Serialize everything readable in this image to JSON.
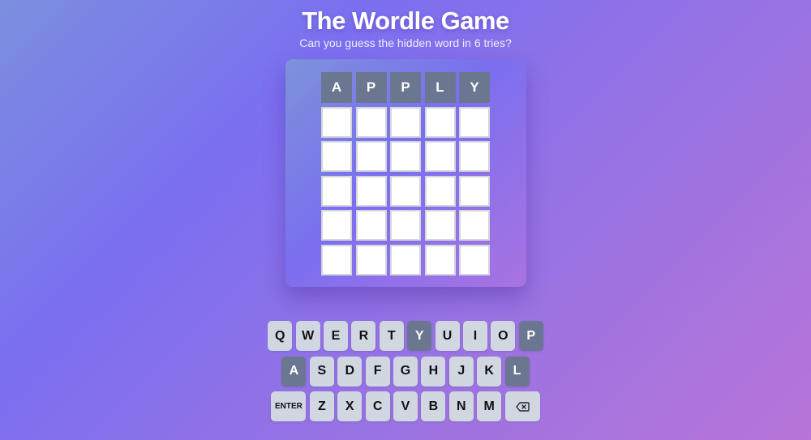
{
  "header": {
    "title": "The Wordle Game",
    "subtitle": "Can you guess the hidden word in 6 tries?"
  },
  "board": {
    "rows": [
      [
        "A",
        "P",
        "P",
        "L",
        "Y"
      ],
      [
        "",
        "",
        "",
        "",
        ""
      ],
      [
        "",
        "",
        "",
        "",
        ""
      ],
      [
        "",
        "",
        "",
        "",
        ""
      ],
      [
        "",
        "",
        "",
        "",
        ""
      ],
      [
        "",
        "",
        "",
        "",
        ""
      ]
    ],
    "filled_color": "#6b7790",
    "empty_color": "#ffffff"
  },
  "keyboard": {
    "rows": [
      [
        {
          "label": "Q",
          "used": false
        },
        {
          "label": "W",
          "used": false
        },
        {
          "label": "E",
          "used": false
        },
        {
          "label": "R",
          "used": false
        },
        {
          "label": "T",
          "used": false
        },
        {
          "label": "Y",
          "used": true
        },
        {
          "label": "U",
          "used": false
        },
        {
          "label": "I",
          "used": false
        },
        {
          "label": "O",
          "used": false
        },
        {
          "label": "P",
          "used": true
        }
      ],
      [
        {
          "label": "A",
          "used": true
        },
        {
          "label": "S",
          "used": false
        },
        {
          "label": "D",
          "used": false
        },
        {
          "label": "F",
          "used": false
        },
        {
          "label": "G",
          "used": false
        },
        {
          "label": "H",
          "used": false
        },
        {
          "label": "J",
          "used": false
        },
        {
          "label": "K",
          "used": false
        },
        {
          "label": "L",
          "used": true
        }
      ],
      [
        {
          "label": "ENTER",
          "used": false,
          "wide": true
        },
        {
          "label": "Z",
          "used": false
        },
        {
          "label": "X",
          "used": false
        },
        {
          "label": "C",
          "used": false
        },
        {
          "label": "V",
          "used": false
        },
        {
          "label": "B",
          "used": false
        },
        {
          "label": "N",
          "used": false
        },
        {
          "label": "M",
          "used": false
        },
        {
          "label": "",
          "icon": "backspace-icon",
          "used": false,
          "wide": true
        }
      ]
    ],
    "key_color": "#d1d7e1",
    "used_key_color": "#6b7790"
  }
}
